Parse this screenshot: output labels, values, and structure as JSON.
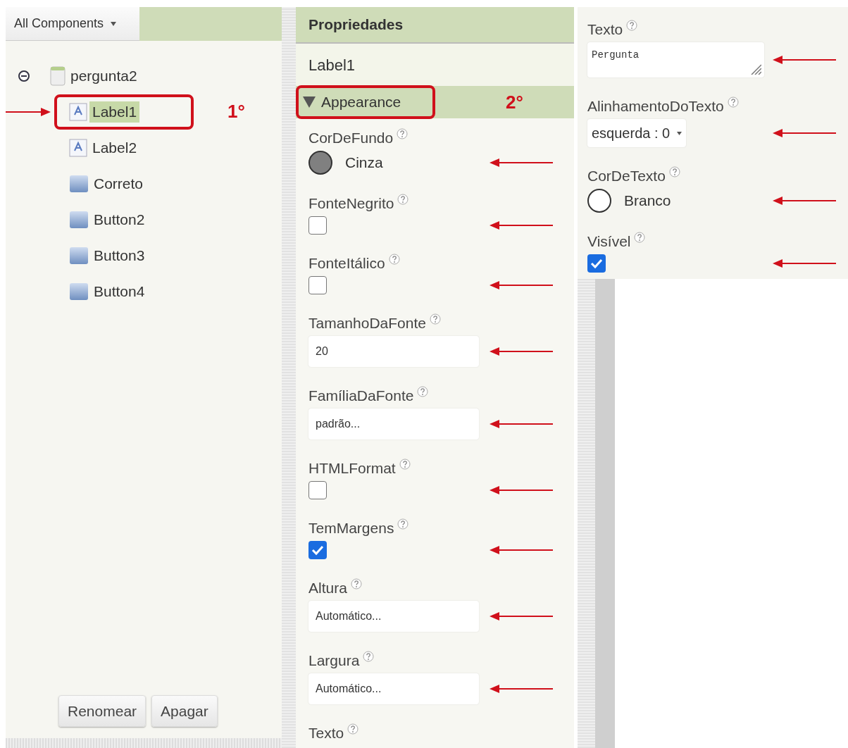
{
  "components": {
    "dropdown": "All Components",
    "tree": [
      {
        "label": "pergunta2",
        "kind": "screen",
        "expanded": true,
        "selected": false,
        "annotated": false,
        "children": [
          {
            "label": "Label1",
            "kind": "label",
            "selected": true,
            "annotated": true,
            "step": "1°"
          },
          {
            "label": "Label2",
            "kind": "label",
            "selected": false,
            "annotated": false
          },
          {
            "label": "Correto",
            "kind": "button",
            "selected": false,
            "annotated": false
          },
          {
            "label": "Button2",
            "kind": "button",
            "selected": false,
            "annotated": false
          },
          {
            "label": "Button3",
            "kind": "button",
            "selected": false,
            "annotated": false
          },
          {
            "label": "Button4",
            "kind": "button",
            "selected": false,
            "annotated": false
          }
        ]
      }
    ],
    "buttons": [
      {
        "label": "Renomear"
      },
      {
        "label": "Apagar"
      }
    ]
  },
  "properties": {
    "title": "Propriedades",
    "component": "Label1",
    "section": {
      "label": "Appearance",
      "expanded": true,
      "annotated": true,
      "step": "2°"
    },
    "columns": [
      [
        {
          "label": "CorDeFundo",
          "kind": "color",
          "value": "Cinza",
          "color": "#808080",
          "annotated": true
        },
        {
          "label": "FonteNegrito",
          "kind": "checkbox",
          "checked": false,
          "annotated": true
        },
        {
          "label": "FonteItálico",
          "kind": "checkbox",
          "checked": false,
          "annotated": true
        },
        {
          "label": "TamanhoDaFonte",
          "kind": "text",
          "value": "20",
          "annotated": true
        },
        {
          "label": "FamíliaDaFonte",
          "kind": "text",
          "value": "padrão...",
          "annotated": true
        },
        {
          "label": "HTMLFormat",
          "kind": "checkbox",
          "checked": false,
          "annotated": true
        },
        {
          "label": "TemMargens",
          "kind": "checkbox",
          "checked": true,
          "annotated": true
        },
        {
          "label": "Altura",
          "kind": "text",
          "value": "Automático...",
          "annotated": true
        },
        {
          "label": "Largura",
          "kind": "text",
          "value": "Automático...",
          "annotated": true
        },
        {
          "label": "Texto",
          "kind": "cut",
          "annotated": false
        }
      ],
      [
        {
          "label": "Texto",
          "kind": "textarea",
          "value": "Pergunta",
          "annotated": true
        },
        {
          "label": "AlinhamentoDoTexto",
          "kind": "select",
          "value": "esquerda : 0",
          "annotated": true
        },
        {
          "label": "CorDeTexto",
          "kind": "color",
          "value": "Branco",
          "color": "#ffffff",
          "annotated": true
        },
        {
          "label": "Visível",
          "kind": "checkbox",
          "checked": true,
          "annotated": true
        }
      ]
    ]
  }
}
